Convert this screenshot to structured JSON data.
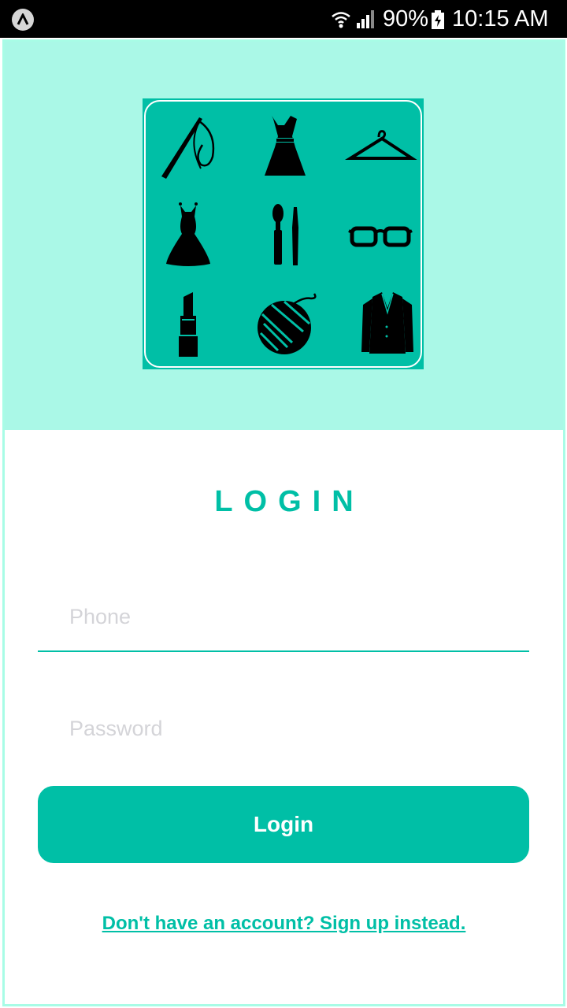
{
  "status_bar": {
    "battery": "90%",
    "time": "10:15 AM",
    "icons": [
      "app-icon",
      "wifi-icon",
      "signal-icon",
      "battery-icon"
    ]
  },
  "logo": {
    "icons": [
      "needle-thread-icon",
      "dress-icon",
      "hanger-icon",
      "gown-icon",
      "makeup-brush-icon",
      "glasses-icon",
      "lipstick-icon",
      "yarn-ball-icon",
      "blazer-icon"
    ]
  },
  "login": {
    "title": "LOGIN",
    "phone_placeholder": "Phone",
    "password_placeholder": "Password",
    "button_label": "Login",
    "signup_link": "Don't have an account? Sign up instead."
  },
  "colors": {
    "accent": "#00bfa6",
    "hero_bg": "#aaf8e7",
    "border": "#a8fce6"
  }
}
